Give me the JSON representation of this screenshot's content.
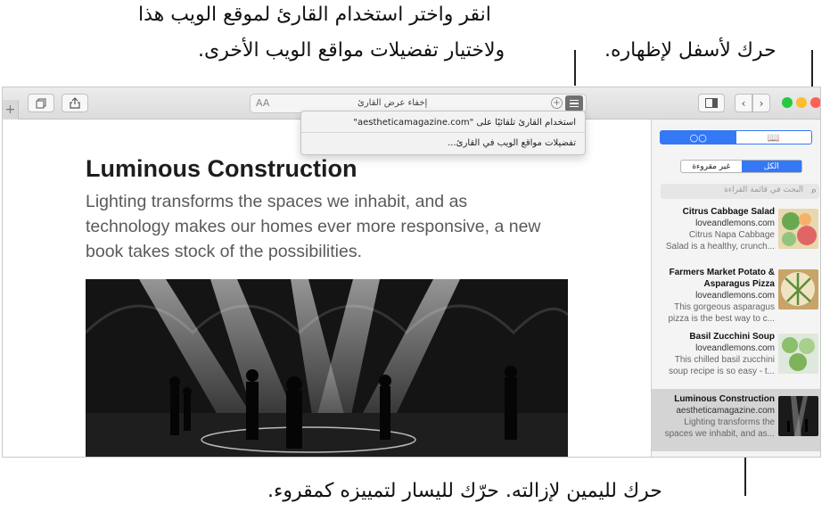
{
  "callouts": {
    "reader_line1": "انقر واختر استخدام القارئ لموقع الويب هذا",
    "reader_line2": "ولاختيار تفضيلات مواقع الويب الأخرى.",
    "pull_down": "حرك لأسفل لإظهاره.",
    "swipe": "حرك لليمين لإزالته. حرّك لليسار لتمييزه كمقروء."
  },
  "toolbar": {
    "address_text": "إخفاء عرض القارئ",
    "aa_label": "AA",
    "plus_label": "+"
  },
  "reader_menu": {
    "item1": "استخدام القارئ تلقائيًا على \"aestheticamagazine.com\"",
    "item2": "تفضيلات مواقع الويب في القارئ..."
  },
  "article": {
    "title": "Luminous Construction",
    "subtitle": "Lighting transforms the spaces we inhabit, and as technology makes our homes ever more responsive, a new book takes stock of the possibilities."
  },
  "sidebar": {
    "tab_reading_list_icon": "glasses-icon",
    "tab_bookmarks_icon": "book-icon",
    "filter_all": "الكل",
    "filter_unread": "غير مقروءة",
    "search_placeholder": "البحث في قائمة القراءة",
    "items": [
      {
        "title": "Citrus Cabbage Salad",
        "site": "loveandlemons.com",
        "desc1": "Citrus Napa Cabbage",
        "desc2": "Salad is a healthy, crunch..."
      },
      {
        "title": "Farmers Market Potato &",
        "title2": "Asparagus Pizza",
        "site": "loveandlemons.com",
        "desc1": "This gorgeous asparagus",
        "desc2": "pizza is the best way to c..."
      },
      {
        "title": "Basil Zucchini Soup",
        "site": "loveandlemons.com",
        "desc1": "This chilled basil zucchini",
        "desc2": "soup recipe is so easy - t..."
      },
      {
        "title": "Luminous Construction",
        "site": "aestheticamagazine.com",
        "desc1": "Lighting transforms the",
        "desc2": "spaces we inhabit, and as..."
      }
    ]
  },
  "colors": {
    "accent": "#3478f6",
    "close": "#fe5f57",
    "minimize": "#febc2e",
    "zoom": "#28c840"
  }
}
